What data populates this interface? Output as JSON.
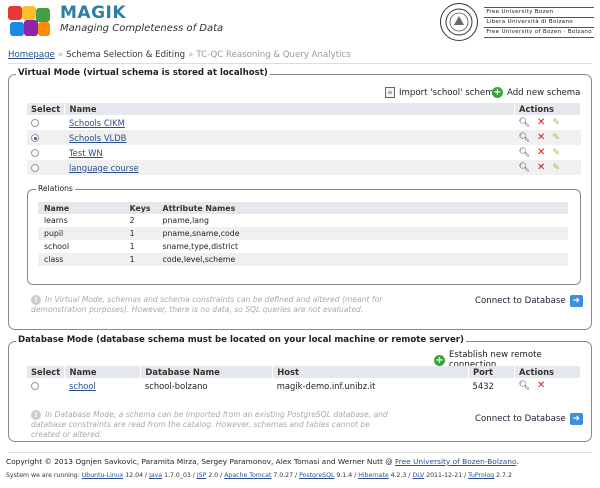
{
  "brand": {
    "name": "MAGIK",
    "subtitle": "Managing Completeness of Data"
  },
  "university": {
    "lines": [
      "Free University Bozen",
      "Libera Università di Bolzano",
      "Free University of Bozen · Bolzano"
    ]
  },
  "breadcrumb": {
    "home": "Homepage",
    "current": "Schema Selection & Editing",
    "next": "TC-QC Reasoning & Query Analytics",
    "sep": "»"
  },
  "virtual": {
    "legend": "Virtual Mode (virtual schema is stored at localhost)",
    "import_label": "Import 'school' schema",
    "add_label": "Add new schema",
    "headers": [
      "Select",
      "Name",
      "Actions"
    ],
    "rows": [
      {
        "name": "Schools CIKM",
        "selected": false
      },
      {
        "name": "Schools VLDB",
        "selected": true
      },
      {
        "name": "Test WN",
        "selected": false
      },
      {
        "name": "language course",
        "selected": false
      }
    ],
    "relations": {
      "legend": "Relations",
      "headers": [
        "Name",
        "Keys",
        "Attribute Names"
      ],
      "rows": [
        {
          "name": "learns",
          "keys": "2",
          "attrs": "pname,lang"
        },
        {
          "name": "pupil",
          "keys": "1",
          "attrs": "pname,sname,code"
        },
        {
          "name": "school",
          "keys": "1",
          "attrs": "sname,type,district"
        },
        {
          "name": "class",
          "keys": "1",
          "attrs": "code,level,scheme"
        }
      ]
    },
    "note": "In Virtual Mode, schemas and schema constraints can be defined and altered (meant for demonstration purposes). However, there is no data, so SQL queries are not evaluated.",
    "connect_label": "Connect to Database"
  },
  "database": {
    "legend": "Database Mode (database schema must be located on your local machine or remote server)",
    "add_label": "Establish new remote connection",
    "headers": [
      "Select",
      "Name",
      "Database Name",
      "Host",
      "Port",
      "Actions"
    ],
    "rows": [
      {
        "name": "school",
        "db": "school-bolzano",
        "host": "magik-demo.inf.unibz.it",
        "port": "5432"
      }
    ],
    "note": "In Database Mode, a schema can be imported from an existing PostgreSQL database, and database constraints are read from the catalog. However, schemas and tables cannot be created or altered.",
    "connect_label": "Connect to Database"
  },
  "footer": {
    "copyright": "Copyright © 2013 Ognjen Savkovic, Paramita Mirza, Sergey Paramonov, Alex Tomasi and Werner Nutt @",
    "university_link": "Free University of Bozen-Bolzano",
    "period": ".",
    "stack_intro": "System we are running:",
    "stack": [
      {
        "name": "Ubuntu-Linux",
        "ver": "12.04"
      },
      {
        "name": "Java",
        "ver": "1.7.0_03"
      },
      {
        "name": "JSP",
        "ver": "2.0"
      },
      {
        "name": "Apache Tomcat",
        "ver": "7.0.27"
      },
      {
        "name": "PostgreSQL",
        "ver": "9.1.4"
      },
      {
        "name": "Hibernate",
        "ver": "4.2.3"
      },
      {
        "name": "DLV",
        "ver": "2011-12-21"
      },
      {
        "name": "TuProlog",
        "ver": "2.7.2"
      }
    ]
  },
  "colors": {
    "brand": "#2c7fa6",
    "link": "#2a4f8a",
    "delete": "#c92222",
    "add": "#3aa33a",
    "arrow": "#3a8fe0"
  }
}
